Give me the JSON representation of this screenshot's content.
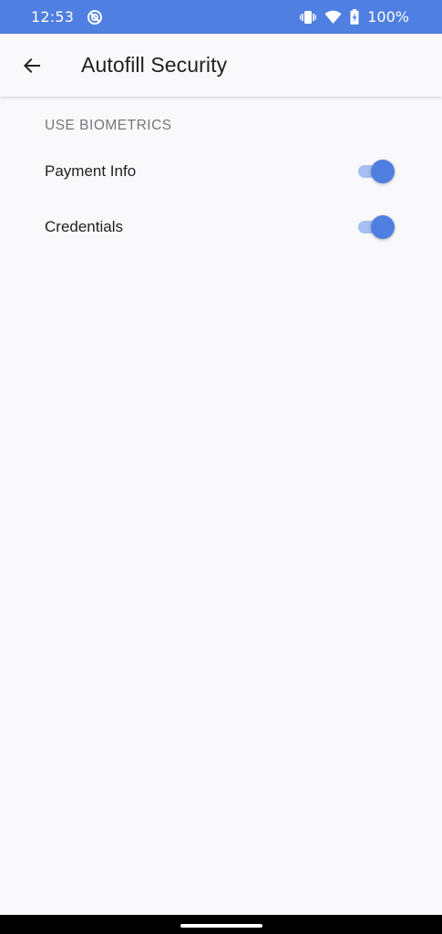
{
  "status_bar": {
    "time": "12:53",
    "battery_text": "100%",
    "icons": [
      "data-saver-icon",
      "vibrate-icon",
      "wifi-icon",
      "battery-charging-icon"
    ]
  },
  "app_bar": {
    "title": "Autofill Security",
    "back_icon": "arrow-back-icon"
  },
  "section": {
    "header": "USE BIOMETRICS",
    "items": [
      {
        "label": "Payment Info",
        "enabled": true
      },
      {
        "label": "Credentials",
        "enabled": true
      }
    ]
  },
  "colors": {
    "accent": "#4f7fe0",
    "toggle_track_on": "#a6bff0",
    "background": "#f9f9fb",
    "text_primary": "#202124",
    "text_secondary": "#75777b"
  }
}
